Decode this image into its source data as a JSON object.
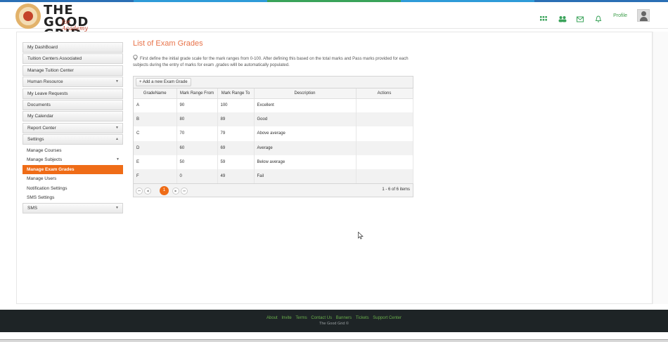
{
  "colors": {
    "accent": "#ef6c17",
    "title": "#e8734a",
    "footer_bg": "#1e2426",
    "link_green": "#6ab04c"
  },
  "header": {
    "logo_text": "THE GOOD GRID",
    "logo_subtitle": "for Academy",
    "icons": [
      "grid-icon",
      "users-icon",
      "mail-icon",
      "bell-icon"
    ],
    "profile_label": "Profile"
  },
  "sidebar": {
    "items": [
      {
        "label": "My DashBoard"
      },
      {
        "label": "Tuition Centers Associated"
      },
      {
        "label": "Manage Tuition Center"
      },
      {
        "label": "Human Resource",
        "caret": "▼"
      },
      {
        "label": "My Leave Requests"
      },
      {
        "label": "Documents"
      },
      {
        "label": "My Calendar"
      },
      {
        "label": "Report Center",
        "caret": "▼"
      },
      {
        "label": "Settings",
        "caret": "▲"
      }
    ],
    "settings_sub": [
      {
        "label": "Manage Courses"
      },
      {
        "label": "Manage Subjects",
        "caret": "▼"
      },
      {
        "label": "Manage Exam Grades"
      },
      {
        "label": "Manage Users"
      },
      {
        "label": "Notification Settings"
      },
      {
        "label": "SMS Settings"
      }
    ],
    "sms": {
      "label": "SMS",
      "caret": "▼"
    }
  },
  "main": {
    "title": "List of Exam Grades",
    "intro": "First define the initial grade scale for the mark ranges from 0-100. After defining this based on the total marks and Pass marks provided for each subjects during the entry of marks for exam ,grades willl be automatically populated."
  },
  "grid": {
    "add_label": "+ Add a new Exam Grade",
    "columns": [
      "GradeName",
      "Mark Range From",
      "Mark Range To",
      "Description",
      "Actions"
    ],
    "rows": [
      [
        "A",
        "90",
        "100",
        "Excellent",
        ""
      ],
      [
        "B",
        "80",
        "89",
        "Good",
        ""
      ],
      [
        "C",
        "70",
        "79",
        "Above average",
        ""
      ],
      [
        "D",
        "60",
        "69",
        "Average",
        ""
      ],
      [
        "E",
        "50",
        "59",
        "Below average",
        ""
      ],
      [
        "F",
        "0",
        "49",
        "Fail",
        ""
      ]
    ],
    "pager": {
      "first": "⏮",
      "prev": "◀",
      "current": "1",
      "next": "▶",
      "last": "⏭",
      "info": "1 - 6 of 6 items"
    }
  },
  "footer": {
    "links": [
      "About",
      "Invite",
      "Terms",
      "Contact Us",
      "Banners",
      "Tickets",
      "Support Center"
    ],
    "copyright": "The Good Grid ©"
  }
}
